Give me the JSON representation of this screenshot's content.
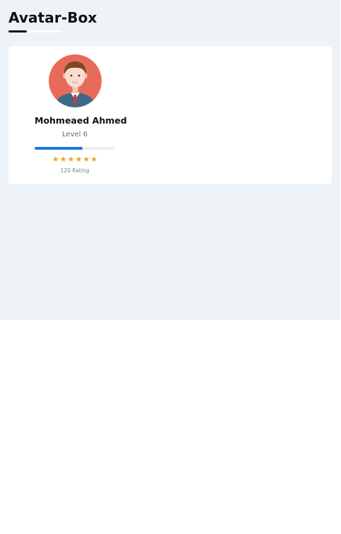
{
  "page": {
    "title": "Avatar-Box"
  },
  "profile": {
    "avatar_icon": "male-person-avatar-icon",
    "name": "Mohmeaed Ahmed",
    "level": "Level 6",
    "progress": 0.6,
    "stars": 6,
    "rating_text": "120 Rating"
  },
  "colors": {
    "page_background": "#eef3f8",
    "card_background": "#ffffff",
    "avatar_background": "#e76b5a",
    "progress_fill": "#1877e6",
    "progress_track": "#eeeeee",
    "star": "#f0a21c",
    "title": "#0f1117"
  }
}
